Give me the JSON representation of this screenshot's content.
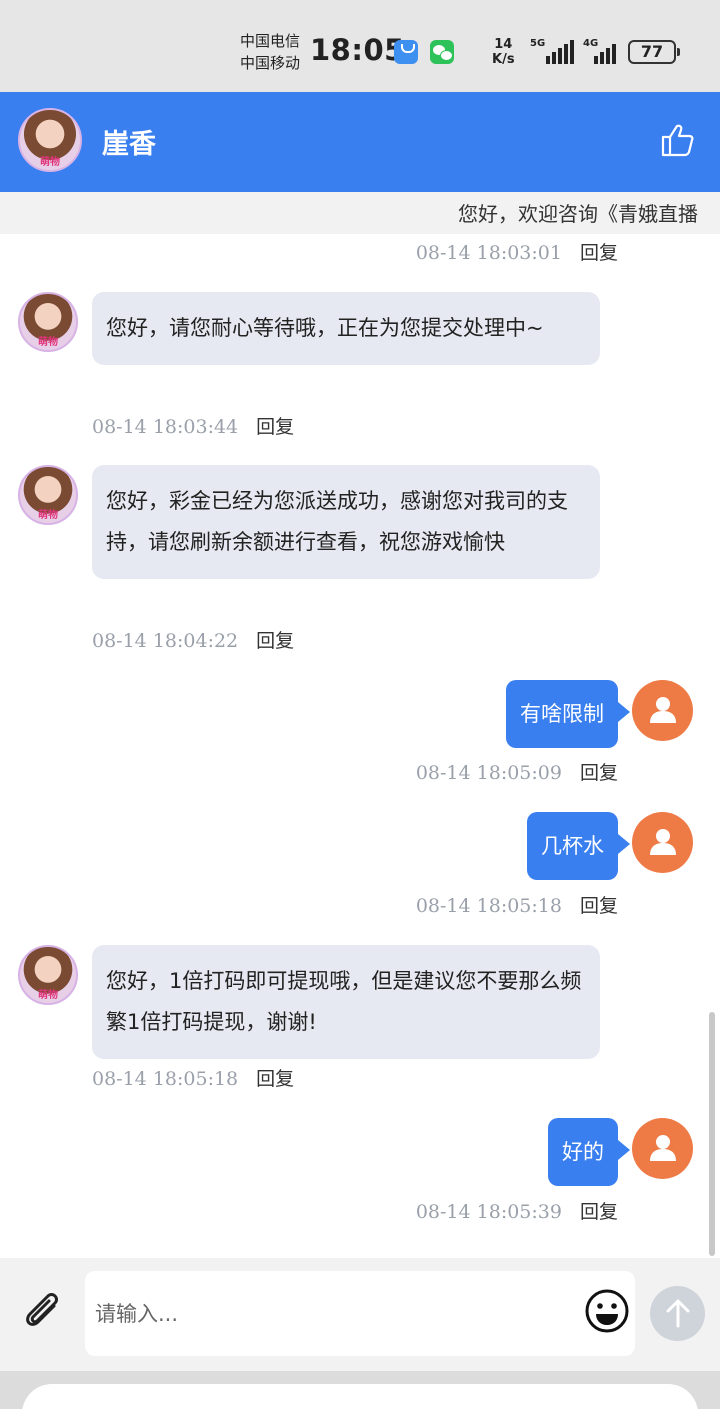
{
  "status_bar": {
    "carrier_1": "中国电信",
    "carrier_2": "中国移动",
    "time": "18:05",
    "net_speed_value": "14",
    "net_speed_unit": "K/s",
    "signal_1": "5G",
    "signal_2": "4G",
    "battery": "77"
  },
  "header": {
    "title": "崖香",
    "avatar_tag": "萌物"
  },
  "marquee": {
    "text": "您好，欢迎咨询《青娥直播"
  },
  "messages": [
    {
      "side": "in",
      "time": "08-14 18:03:01",
      "reply": "回复"
    },
    {
      "side": "in",
      "text": "您好，请您耐心等待哦，正在为您提交处理中~",
      "time": "08-14 18:03:44",
      "reply": "回复"
    },
    {
      "side": "in",
      "text": "您好，彩金已经为您派送成功，感谢您对我司的支持，请您刷新余额进行查看，祝您游戏愉快",
      "time": "08-14 18:04:22",
      "reply": "回复"
    },
    {
      "side": "out",
      "text": "有啥限制",
      "time": "08-14 18:05:09",
      "reply": "回复"
    },
    {
      "side": "out",
      "text": "几杯水",
      "time": "08-14 18:05:18",
      "reply": "回复"
    },
    {
      "side": "in",
      "text": "您好，1倍打码即可提现哦，但是建议您不要那么频繁1倍打码提现，谢谢!",
      "time": "08-14 18:05:18",
      "reply": "回复"
    },
    {
      "side": "out",
      "text": "好的",
      "time": "08-14 18:05:39",
      "reply": "回复"
    }
  ],
  "input": {
    "placeholder": "请输入..."
  },
  "icons": {
    "like": "thumbs-up-icon",
    "attach": "paperclip-icon",
    "emoji": "smiley-icon",
    "send": "arrow-up-icon",
    "user": "person-icon"
  },
  "colors": {
    "accent": "#3a7ff0",
    "user_avatar": "#ee7a45",
    "incoming_bubble": "#e6e9f1"
  }
}
